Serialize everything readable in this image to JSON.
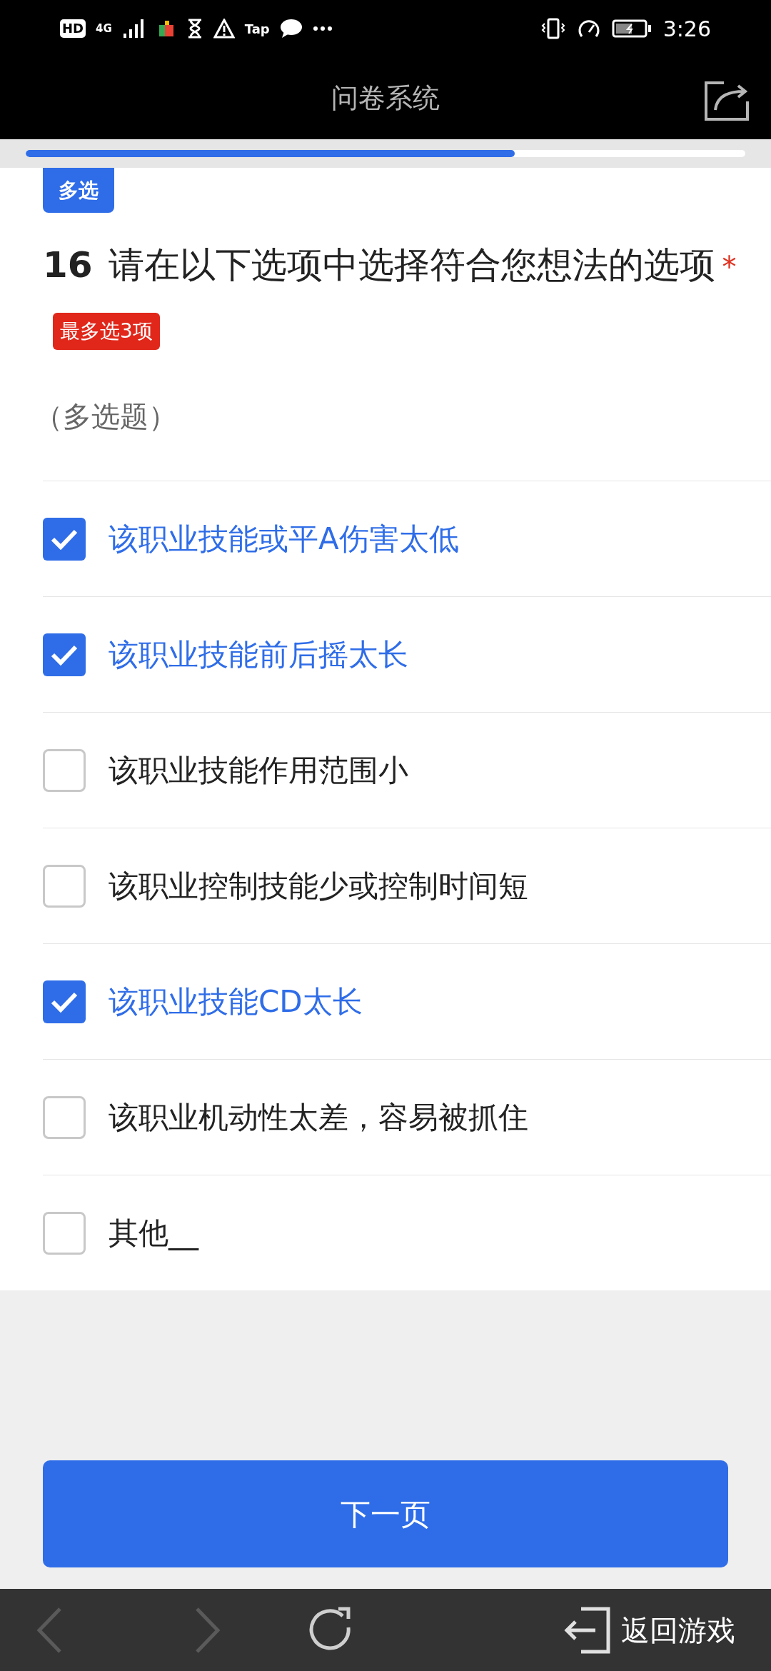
{
  "status_bar": {
    "hd": "HD",
    "network": "4G",
    "tap": "Tap",
    "time": "3:26"
  },
  "header": {
    "title": "问卷系统"
  },
  "progress": {
    "level": 0.68
  },
  "question": {
    "type_badge": "多选",
    "number": "16",
    "text": "请在以下选项中选择符合您想法的选项",
    "required_mark": "*",
    "limit_badge": "最多选3项",
    "hint": "（多选题）",
    "options": [
      {
        "label": "该职业技能或平A伤害太低",
        "checked": true
      },
      {
        "label": "该职业技能前后摇太长",
        "checked": true
      },
      {
        "label": "该职业技能作用范围小",
        "checked": false
      },
      {
        "label": "该职业控制技能少或控制时间短",
        "checked": false
      },
      {
        "label": "该职业技能CD太长",
        "checked": true
      },
      {
        "label": "该职业机动性太差，容易被抓住",
        "checked": false
      },
      {
        "label": "其他__",
        "checked": false
      }
    ]
  },
  "next_button": "下一页",
  "bottom_bar": {
    "back": {
      "disabled": true
    },
    "forward": {
      "disabled": true
    },
    "exit_label": "返回游戏"
  }
}
